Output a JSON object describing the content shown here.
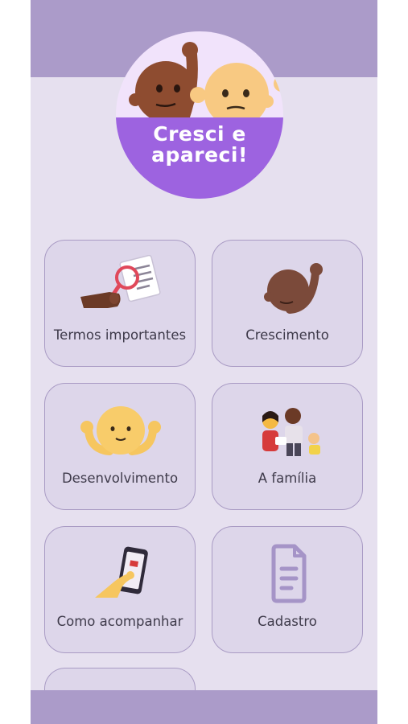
{
  "logo": {
    "line1": "Cresci e",
    "line2": "apareci!"
  },
  "menu": [
    {
      "label": "Termos importantes",
      "icon": "magnifier-document-icon"
    },
    {
      "label": "Crescimento",
      "icon": "baby-waving-icon"
    },
    {
      "label": "Desenvolvimento",
      "icon": "baby-arms-up-icon"
    },
    {
      "label": "A família",
      "icon": "family-icon"
    },
    {
      "label": "Como acompanhar",
      "icon": "hand-phone-icon"
    },
    {
      "label": "Cadastro",
      "icon": "document-icon"
    }
  ],
  "colors": {
    "background": "#e6e0ef",
    "bar": "#ab9bc9",
    "accent": "#9d63e0",
    "tile_border": "#a99bc4"
  }
}
